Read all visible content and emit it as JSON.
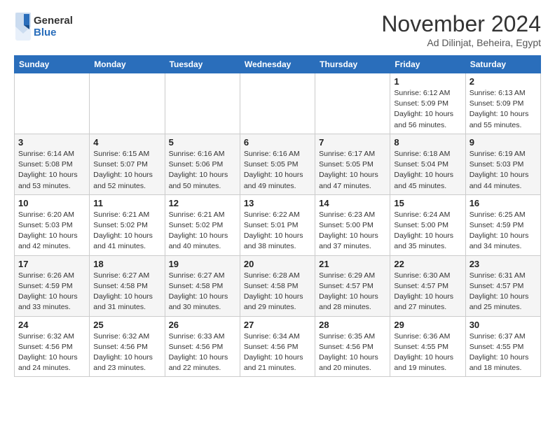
{
  "header": {
    "logo_general": "General",
    "logo_blue": "Blue",
    "month_title": "November 2024",
    "location": "Ad Dilinjat, Beheira, Egypt"
  },
  "weekdays": [
    "Sunday",
    "Monday",
    "Tuesday",
    "Wednesday",
    "Thursday",
    "Friday",
    "Saturday"
  ],
  "weeks": [
    [
      {
        "day": "",
        "info": ""
      },
      {
        "day": "",
        "info": ""
      },
      {
        "day": "",
        "info": ""
      },
      {
        "day": "",
        "info": ""
      },
      {
        "day": "",
        "info": ""
      },
      {
        "day": "1",
        "info": "Sunrise: 6:12 AM\nSunset: 5:09 PM\nDaylight: 10 hours and 56 minutes."
      },
      {
        "day": "2",
        "info": "Sunrise: 6:13 AM\nSunset: 5:09 PM\nDaylight: 10 hours and 55 minutes."
      }
    ],
    [
      {
        "day": "3",
        "info": "Sunrise: 6:14 AM\nSunset: 5:08 PM\nDaylight: 10 hours and 53 minutes."
      },
      {
        "day": "4",
        "info": "Sunrise: 6:15 AM\nSunset: 5:07 PM\nDaylight: 10 hours and 52 minutes."
      },
      {
        "day": "5",
        "info": "Sunrise: 6:16 AM\nSunset: 5:06 PM\nDaylight: 10 hours and 50 minutes."
      },
      {
        "day": "6",
        "info": "Sunrise: 6:16 AM\nSunset: 5:05 PM\nDaylight: 10 hours and 49 minutes."
      },
      {
        "day": "7",
        "info": "Sunrise: 6:17 AM\nSunset: 5:05 PM\nDaylight: 10 hours and 47 minutes."
      },
      {
        "day": "8",
        "info": "Sunrise: 6:18 AM\nSunset: 5:04 PM\nDaylight: 10 hours and 45 minutes."
      },
      {
        "day": "9",
        "info": "Sunrise: 6:19 AM\nSunset: 5:03 PM\nDaylight: 10 hours and 44 minutes."
      }
    ],
    [
      {
        "day": "10",
        "info": "Sunrise: 6:20 AM\nSunset: 5:03 PM\nDaylight: 10 hours and 42 minutes."
      },
      {
        "day": "11",
        "info": "Sunrise: 6:21 AM\nSunset: 5:02 PM\nDaylight: 10 hours and 41 minutes."
      },
      {
        "day": "12",
        "info": "Sunrise: 6:21 AM\nSunset: 5:02 PM\nDaylight: 10 hours and 40 minutes."
      },
      {
        "day": "13",
        "info": "Sunrise: 6:22 AM\nSunset: 5:01 PM\nDaylight: 10 hours and 38 minutes."
      },
      {
        "day": "14",
        "info": "Sunrise: 6:23 AM\nSunset: 5:00 PM\nDaylight: 10 hours and 37 minutes."
      },
      {
        "day": "15",
        "info": "Sunrise: 6:24 AM\nSunset: 5:00 PM\nDaylight: 10 hours and 35 minutes."
      },
      {
        "day": "16",
        "info": "Sunrise: 6:25 AM\nSunset: 4:59 PM\nDaylight: 10 hours and 34 minutes."
      }
    ],
    [
      {
        "day": "17",
        "info": "Sunrise: 6:26 AM\nSunset: 4:59 PM\nDaylight: 10 hours and 33 minutes."
      },
      {
        "day": "18",
        "info": "Sunrise: 6:27 AM\nSunset: 4:58 PM\nDaylight: 10 hours and 31 minutes."
      },
      {
        "day": "19",
        "info": "Sunrise: 6:27 AM\nSunset: 4:58 PM\nDaylight: 10 hours and 30 minutes."
      },
      {
        "day": "20",
        "info": "Sunrise: 6:28 AM\nSunset: 4:58 PM\nDaylight: 10 hours and 29 minutes."
      },
      {
        "day": "21",
        "info": "Sunrise: 6:29 AM\nSunset: 4:57 PM\nDaylight: 10 hours and 28 minutes."
      },
      {
        "day": "22",
        "info": "Sunrise: 6:30 AM\nSunset: 4:57 PM\nDaylight: 10 hours and 27 minutes."
      },
      {
        "day": "23",
        "info": "Sunrise: 6:31 AM\nSunset: 4:57 PM\nDaylight: 10 hours and 25 minutes."
      }
    ],
    [
      {
        "day": "24",
        "info": "Sunrise: 6:32 AM\nSunset: 4:56 PM\nDaylight: 10 hours and 24 minutes."
      },
      {
        "day": "25",
        "info": "Sunrise: 6:32 AM\nSunset: 4:56 PM\nDaylight: 10 hours and 23 minutes."
      },
      {
        "day": "26",
        "info": "Sunrise: 6:33 AM\nSunset: 4:56 PM\nDaylight: 10 hours and 22 minutes."
      },
      {
        "day": "27",
        "info": "Sunrise: 6:34 AM\nSunset: 4:56 PM\nDaylight: 10 hours and 21 minutes."
      },
      {
        "day": "28",
        "info": "Sunrise: 6:35 AM\nSunset: 4:56 PM\nDaylight: 10 hours and 20 minutes."
      },
      {
        "day": "29",
        "info": "Sunrise: 6:36 AM\nSunset: 4:55 PM\nDaylight: 10 hours and 19 minutes."
      },
      {
        "day": "30",
        "info": "Sunrise: 6:37 AM\nSunset: 4:55 PM\nDaylight: 10 hours and 18 minutes."
      }
    ]
  ]
}
